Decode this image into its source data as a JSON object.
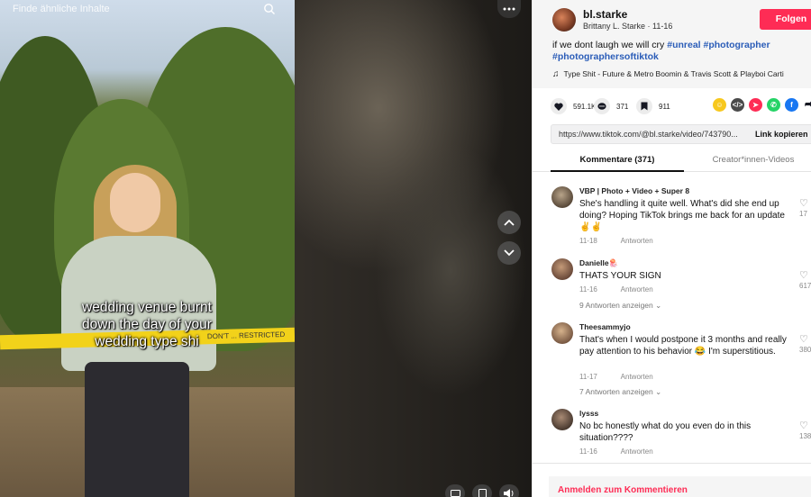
{
  "search": {
    "placeholder": "Finde ähnliche Inhalte"
  },
  "video": {
    "caption_lines": [
      "wedding venue burnt",
      "down the day of your",
      "wedding type shi"
    ],
    "tape_text": "DON'T  ... RESTRICTED"
  },
  "author": {
    "username": "bl.starke",
    "subline": "Brittany L. Starke · 11-16",
    "follow_label": "Folgen"
  },
  "description": {
    "text": "if we dont laugh we will cry ",
    "hashtags": [
      "#unreal",
      "#photographer",
      "#photographersoftiktok"
    ]
  },
  "music": {
    "title": "Type Shit - Future & Metro Boomin & Travis Scott & Playboi Carti"
  },
  "actions": {
    "likes": "591.1K",
    "comments": "371",
    "saves": "911"
  },
  "link": {
    "url": "https://www.tiktok.com/@bl.starke/video/743790...",
    "copy_label": "Link kopieren"
  },
  "tabs": {
    "comments": "Kommentare (371)",
    "creator_videos": "Creator*innen-Videos"
  },
  "comments": [
    {
      "user": "VBP | Photo + Video + Super 8",
      "text": "She's handling it quite well. What's did she end up doing? Hoping TikTok brings me back for an update ✌️✌️",
      "date": "11-18",
      "reply_label": "Antworten",
      "likes": "17",
      "replies": ""
    },
    {
      "user": "Danielle🪼",
      "text": "THATS YOUR SIGN",
      "date": "11-16",
      "reply_label": "Antworten",
      "likes": "617",
      "replies": "9 Antworten anzeigen"
    },
    {
      "user": "Theesammyjo",
      "text": "That's when I would postpone it 3 months and really pay attention to his behavior 😂 I'm superstitious.",
      "date": "11-17",
      "reply_label": "Antworten",
      "likes": "380",
      "replies": "7 Antworten anzeigen"
    },
    {
      "user": "lysss",
      "text": "No bc honestly what do you even do in this situation????",
      "date": "11-16",
      "reply_label": "Antworten",
      "likes": "138",
      "replies": ""
    }
  ],
  "login": {
    "label": "Anmelden zum Kommentieren"
  },
  "colors": {
    "accent": "#fe2c55",
    "hashtag": "#2b5db8"
  }
}
